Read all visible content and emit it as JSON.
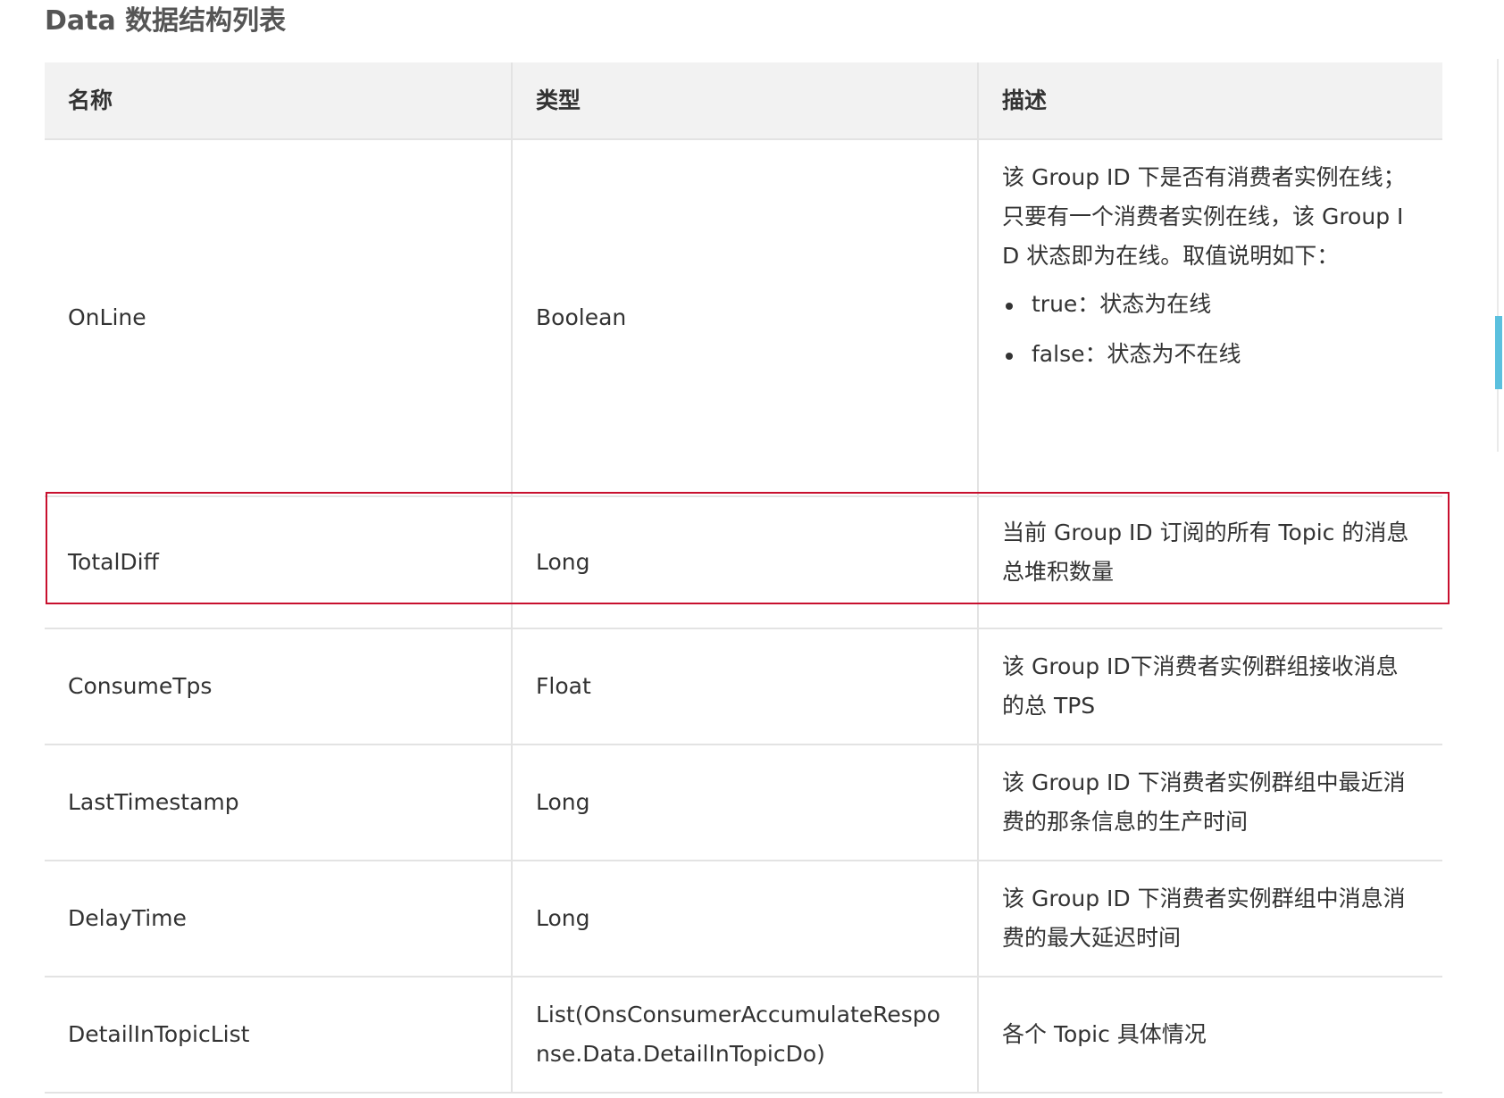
{
  "section": {
    "title": "Data 数据结构列表"
  },
  "table": {
    "headers": {
      "name": "名称",
      "type": "类型",
      "desc": "描述"
    },
    "rows": [
      {
        "name": "OnLine",
        "type": "Boolean",
        "desc": "该 Group ID 下是否有消费者实例在线；只要有一个消费者实例在线，该 Group ID 状态即为在线。取值说明如下：",
        "list": [
          "true：状态为在线",
          "false：状态为不在线"
        ]
      },
      {
        "name": "TotalDiff",
        "type": "Long",
        "desc": "当前 Group ID 订阅的所有 Topic 的消息总堆积数量"
      },
      {
        "name": "ConsumeTps",
        "type": "Float",
        "desc": "该 Group ID下消费者实例群组接收消息的总 TPS"
      },
      {
        "name": "LastTimestamp",
        "type": "Long",
        "desc": "该 Group ID 下消费者实例群组中最近消费的那条信息的生产时间"
      },
      {
        "name": "DelayTime",
        "type": "Long",
        "desc": "该 Group ID 下消费者实例群组中消息消费的最大延迟时间"
      },
      {
        "name": "DetailInTopicList",
        "type": "List(OnsConsumerAccumulateResponse.Data.DetailInTopicDo)",
        "desc": "各个 Topic 具体情况"
      }
    ]
  },
  "colors": {
    "highlight": "#c8102e",
    "scroll_thumb": "#5bc0de",
    "header_bg": "#f2f2f2"
  }
}
